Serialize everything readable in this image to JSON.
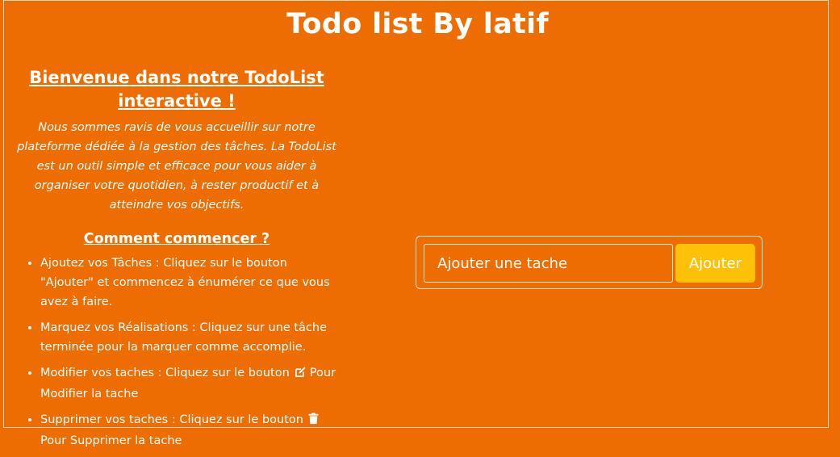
{
  "app": {
    "title": "Todo list By latif"
  },
  "welcome": {
    "title": "Bienvenue dans notre TodoList interactive !",
    "intro": "Nous sommes ravis de vous accueillir sur notre plateforme dédiée à la gestion des tâches. La TodoList est un outil simple et efficace pour vous aider à organiser votre quotidien, à rester productif et à atteindre vos objectifs."
  },
  "howto": {
    "title": "Comment commencer ?",
    "steps": [
      {
        "text": "Ajoutez vos Tâches : Cliquez sur le bouton \"Ajouter\" et commencez à énumérer ce que vous avez à faire."
      },
      {
        "text": "Marquez vos Réalisations : Cliquez sur une tâche terminée pour la marquer comme accomplie."
      },
      {
        "text_before": "Modifier vos taches : Cliquez sur le bouton",
        "icon": "edit-icon",
        "text_after": "Pour Modifier la tache"
      },
      {
        "text_before": "Supprimer vos taches : Cliquez sur le bouton",
        "icon": "trash-icon",
        "text_after": "Pour Supprimer la tache"
      }
    ]
  },
  "form": {
    "input_placeholder": "Ajouter une tache",
    "input_value": "",
    "add_label": "Ajouter"
  },
  "colors": {
    "background": "#ee6d02",
    "button": "#ffc107",
    "text": "#ffffff"
  }
}
